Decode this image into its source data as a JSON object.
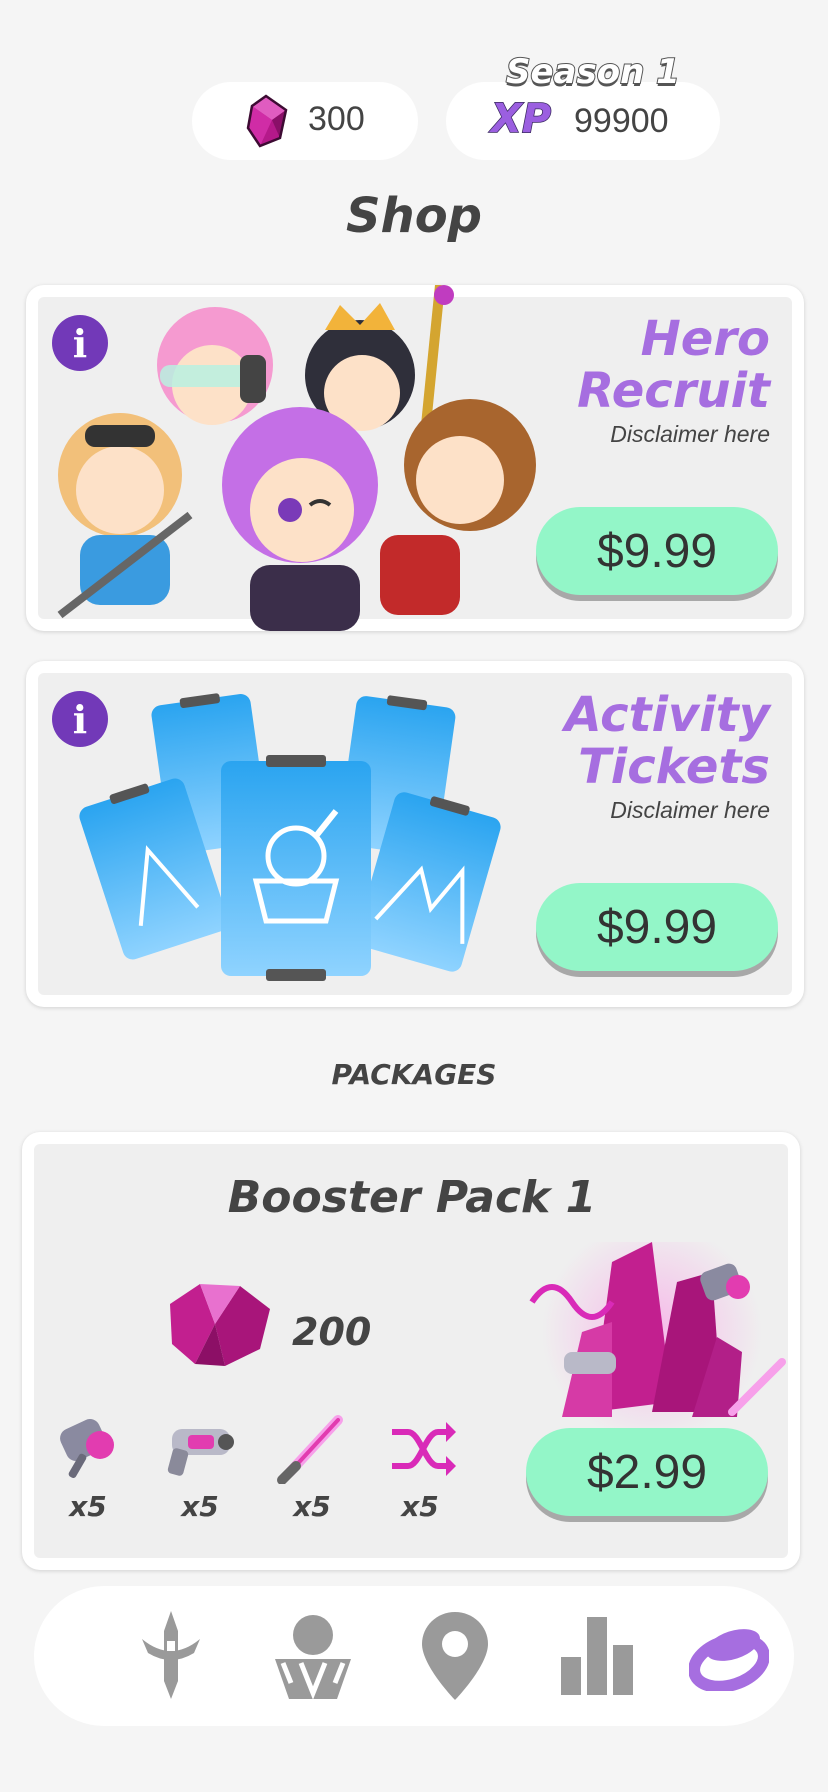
{
  "header": {
    "gems": "300",
    "season_label": "Season 1",
    "xp_label": "XP",
    "xp_value": "99900"
  },
  "title": "Shop",
  "offers": [
    {
      "title_line1": "Hero",
      "title_line2": "Recruit",
      "disclaimer": "Disclaimer here",
      "price": "$9.99"
    },
    {
      "title_line1": "Activity",
      "title_line2": "Tickets",
      "disclaimer": "Disclaimer here",
      "price": "$9.99"
    }
  ],
  "packages_header": "PACKAGES",
  "booster": {
    "title": "Booster Pack 1",
    "gem_amount": "200",
    "items": [
      {
        "icon": "hammer-icon",
        "qty": "x5"
      },
      {
        "icon": "raygun-icon",
        "qty": "x5"
      },
      {
        "icon": "lightsaber-icon",
        "qty": "x5"
      },
      {
        "icon": "shuffle-icon",
        "qty": "x5"
      }
    ],
    "price": "$2.99"
  },
  "nav": {
    "items": [
      "sword-icon",
      "heroes-icon",
      "map-pin-icon",
      "leaderboard-icon",
      "shop-icon"
    ],
    "active": "shop-icon",
    "active_color": "#a66ee0",
    "inactive_color": "#9a9a9a"
  },
  "colors": {
    "accent_purple": "#a66ee0",
    "info_purple": "#7239b8",
    "price_green": "#93f6c8",
    "gem_magenta": "#c21f8f"
  }
}
